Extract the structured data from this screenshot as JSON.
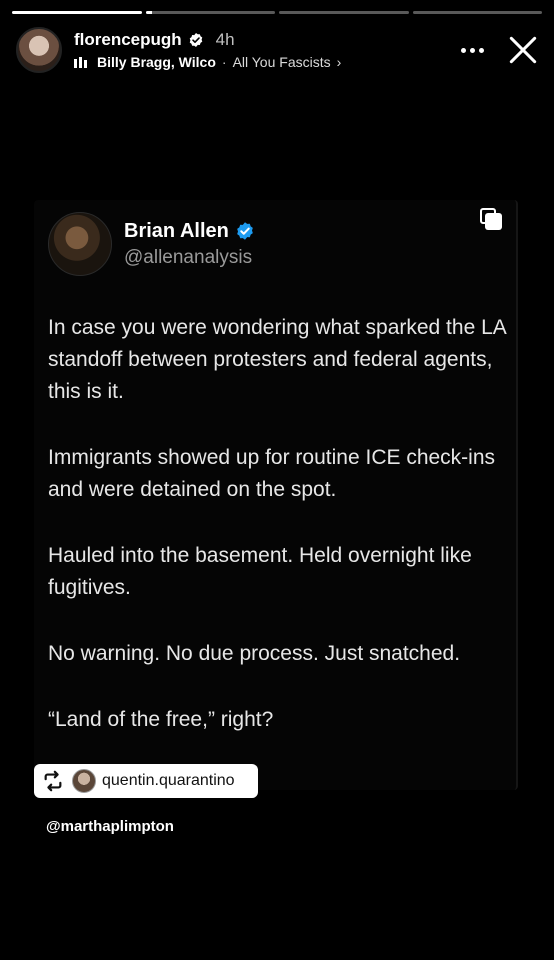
{
  "progress": [
    1,
    0.05,
    0,
    0
  ],
  "header": {
    "username": "florencepugh",
    "time": "4h",
    "song_artist": "Billy Bragg, Wilco",
    "song_separator": "·",
    "song_title": "All You Fascists",
    "chevron": "›"
  },
  "tweet": {
    "name": "Brian Allen",
    "handle": "@allenanalysis",
    "paragraphs": [
      "In case you were wondering what sparked the LA standoff between protesters and federal agents, this is it.",
      "Immigrants showed up for routine ICE check-ins and were detained on the spot.",
      "Hauled into the basement. Held overnight like fugitives.",
      "No warning. No due process. Just snatched.",
      "“Land of the free,” right?"
    ]
  },
  "repost_tag": {
    "username": "quentin.quarantino"
  },
  "mention": "@marthaplimpton",
  "colors": {
    "verified": "#1d9bf0",
    "background": "#000000"
  },
  "icons": {
    "verified": "verified-badge-icon",
    "equalizer": "equalizer-icon",
    "more": "more-icon",
    "close": "close-icon",
    "copy": "copy-icon",
    "repost": "repost-icon"
  }
}
